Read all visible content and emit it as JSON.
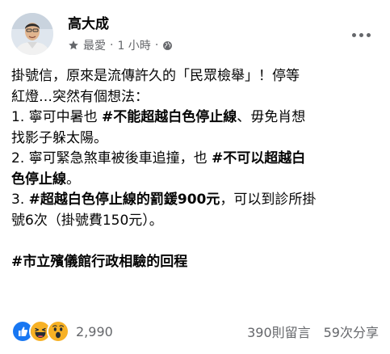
{
  "post": {
    "author": "高大成",
    "audience": "最愛",
    "separator": "·",
    "time": "1 小時",
    "lines": [
      [
        {
          "t": "掛號信，原來是流傳許久的「民眾檢舉」！停等"
        }
      ],
      [
        {
          "t": "紅燈…突然有個想法："
        }
      ],
      [
        {
          "t": "1. 寧可中暑也 "
        },
        {
          "t": "#不能超越白色停止線",
          "b": true
        },
        {
          "t": "、毋免肖想"
        }
      ],
      [
        {
          "t": "找影子躲太陽。"
        }
      ],
      [
        {
          "t": "2. 寧可緊急煞車被後車追撞，也 "
        },
        {
          "t": "#不可以超越白",
          "b": true
        }
      ],
      [
        {
          "t": "色停止線",
          "b": true
        },
        {
          "t": "。"
        }
      ],
      [
        {
          "t": "3. "
        },
        {
          "t": "#超越白色停止線的罰鍰900元",
          "b": true
        },
        {
          "t": "，可以到診所掛"
        }
      ],
      [
        {
          "t": "號6次（掛號費150元）。"
        }
      ],
      [],
      [
        {
          "t": "#市立殯儀館行政相驗的回程",
          "b": true
        }
      ]
    ]
  },
  "footer": {
    "reaction_icons": [
      "like-icon",
      "haha-icon",
      "wow-icon"
    ],
    "reaction_count": "2,990",
    "comments": "390則留言",
    "shares": "59次分享"
  },
  "colors": {
    "like": "#1877f2",
    "reaction_yellow": "#f7b125",
    "meta_gray": "#65676b",
    "text": "#050505"
  }
}
